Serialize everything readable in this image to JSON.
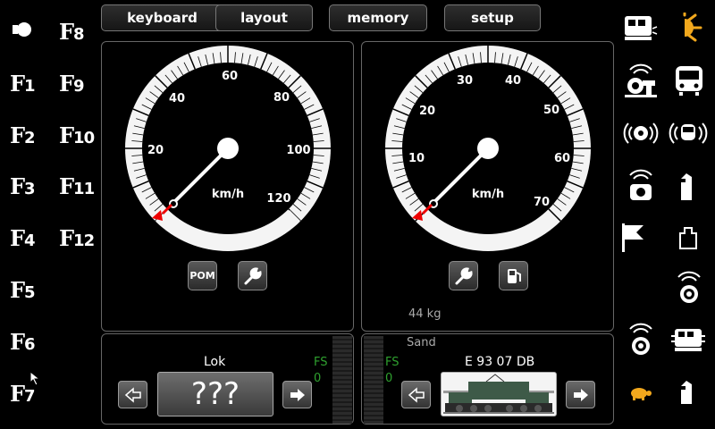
{
  "function_keys_left": [
    {
      "prefix": "F",
      "num": "8"
    },
    {
      "prefix": "F",
      "num": "1"
    },
    {
      "prefix": "F",
      "num": "9"
    },
    {
      "prefix": "F",
      "num": "2"
    },
    {
      "prefix": "F",
      "num": "10"
    },
    {
      "prefix": "F",
      "num": "3"
    },
    {
      "prefix": "F",
      "num": "11"
    },
    {
      "prefix": "F",
      "num": "4"
    },
    {
      "prefix": "F",
      "num": "12"
    },
    {
      "prefix": "F",
      "num": "5"
    },
    {
      "prefix": "F",
      "num": "6"
    },
    {
      "prefix": "F",
      "num": "7"
    }
  ],
  "toolbar": {
    "keyboard": "keyboard",
    "layout": "layout",
    "memory": "memory",
    "setup": "setup"
  },
  "throttle_left": {
    "unit": "km/h",
    "ticks": [
      "20",
      "40",
      "60",
      "80",
      "100",
      "120"
    ],
    "pom_label": "POM",
    "loco_name": "Lok",
    "loco_image_text": "???",
    "speed_step_label": "FS",
    "speed_step_value": "0"
  },
  "throttle_right": {
    "unit": "km/h",
    "ticks": [
      "10",
      "20",
      "30",
      "40",
      "50",
      "60",
      "70"
    ],
    "weight": "44 kg",
    "sand_label": "Sand",
    "loco_name": "E 93 07 DB",
    "speed_step_label": "FS",
    "speed_step_value": "0"
  },
  "right_icons": [
    "train-lights-icon",
    "sun-light-icon",
    "turntable-sound-icon",
    "railcar-front-icon",
    "fan-sound-icon",
    "train-sound-icon",
    "compressor-sound-icon",
    "pantograph-icon",
    "flag-icon",
    "weight-icon",
    "loudspeaker-icon",
    "horn-sound-icon",
    "coupler-icon",
    "turtle-slow-icon",
    "rail-icon"
  ]
}
